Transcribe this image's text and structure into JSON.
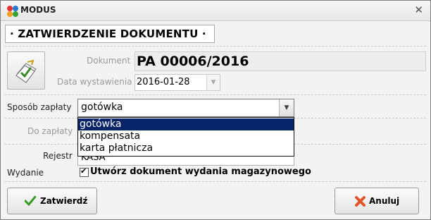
{
  "window": {
    "title": "MODUS",
    "close_glyph": "✕"
  },
  "header": {
    "title": "· ZATWIERDZENIE DOKUMENTU ·"
  },
  "document": {
    "label": "Dokument",
    "number": "PA 00006/2016",
    "date_label": "Data wystawienia",
    "date_value": "2016-01-28"
  },
  "payment": {
    "label": "Sposób zapłaty",
    "selected": "gotówka",
    "options": [
      "gotówka",
      "kompensata",
      "karta płatnicza"
    ],
    "highlighted_index": 0
  },
  "due": {
    "label": "Do zapłaty"
  },
  "register": {
    "label": "Rejestr",
    "value": "KASA"
  },
  "issue": {
    "label": "Wydanie",
    "checkbox_checked": true,
    "checkbox_label": "Utwórz dokument wydania magazynowego"
  },
  "buttons": {
    "confirm": "Zatwierdź",
    "cancel": "Anuluj"
  },
  "icons": {
    "app": "modus-logo-icon",
    "document": "document-approve-icon",
    "confirm": "checkmark-icon",
    "cancel": "cross-icon"
  },
  "colors": {
    "selection": "#0a246a",
    "confirm_icon": "#3a9a2a",
    "cancel_icon": "#e0552a"
  }
}
